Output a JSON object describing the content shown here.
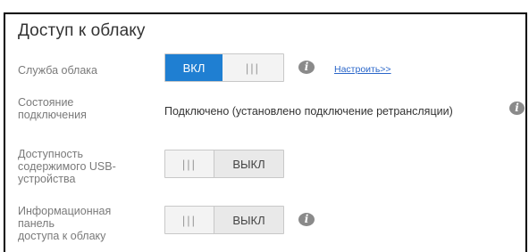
{
  "panel": {
    "title": "Доступ к облаку"
  },
  "rows": {
    "cloud_service": {
      "label": "Служба облака",
      "toggle_on_label": "ВКЛ",
      "grip": "|||",
      "state": "on",
      "link_text": "Настроить>>"
    },
    "connection_status": {
      "label_line1": "Состояние",
      "label_line2": "подключения",
      "value": "Подключено (установлено подключение ретрансляции)"
    },
    "usb_content": {
      "label_line1": "Доступность",
      "label_line2": "содержимого USB-",
      "label_line3": "устройства",
      "grip": "|||",
      "toggle_off_label": "ВЫКЛ",
      "state": "off"
    },
    "dashboard_access": {
      "label_line1": "Информационная",
      "label_line2": "панель",
      "label_line3": "доступа к облаку",
      "grip": "|||",
      "toggle_off_label": "ВЫКЛ",
      "state": "off"
    }
  },
  "icons": {
    "info": "info-icon",
    "info_glyph": "i"
  },
  "colors": {
    "accent_on": "#1f7fd2",
    "link": "#2a66c9",
    "label": "#7a7a7a"
  }
}
